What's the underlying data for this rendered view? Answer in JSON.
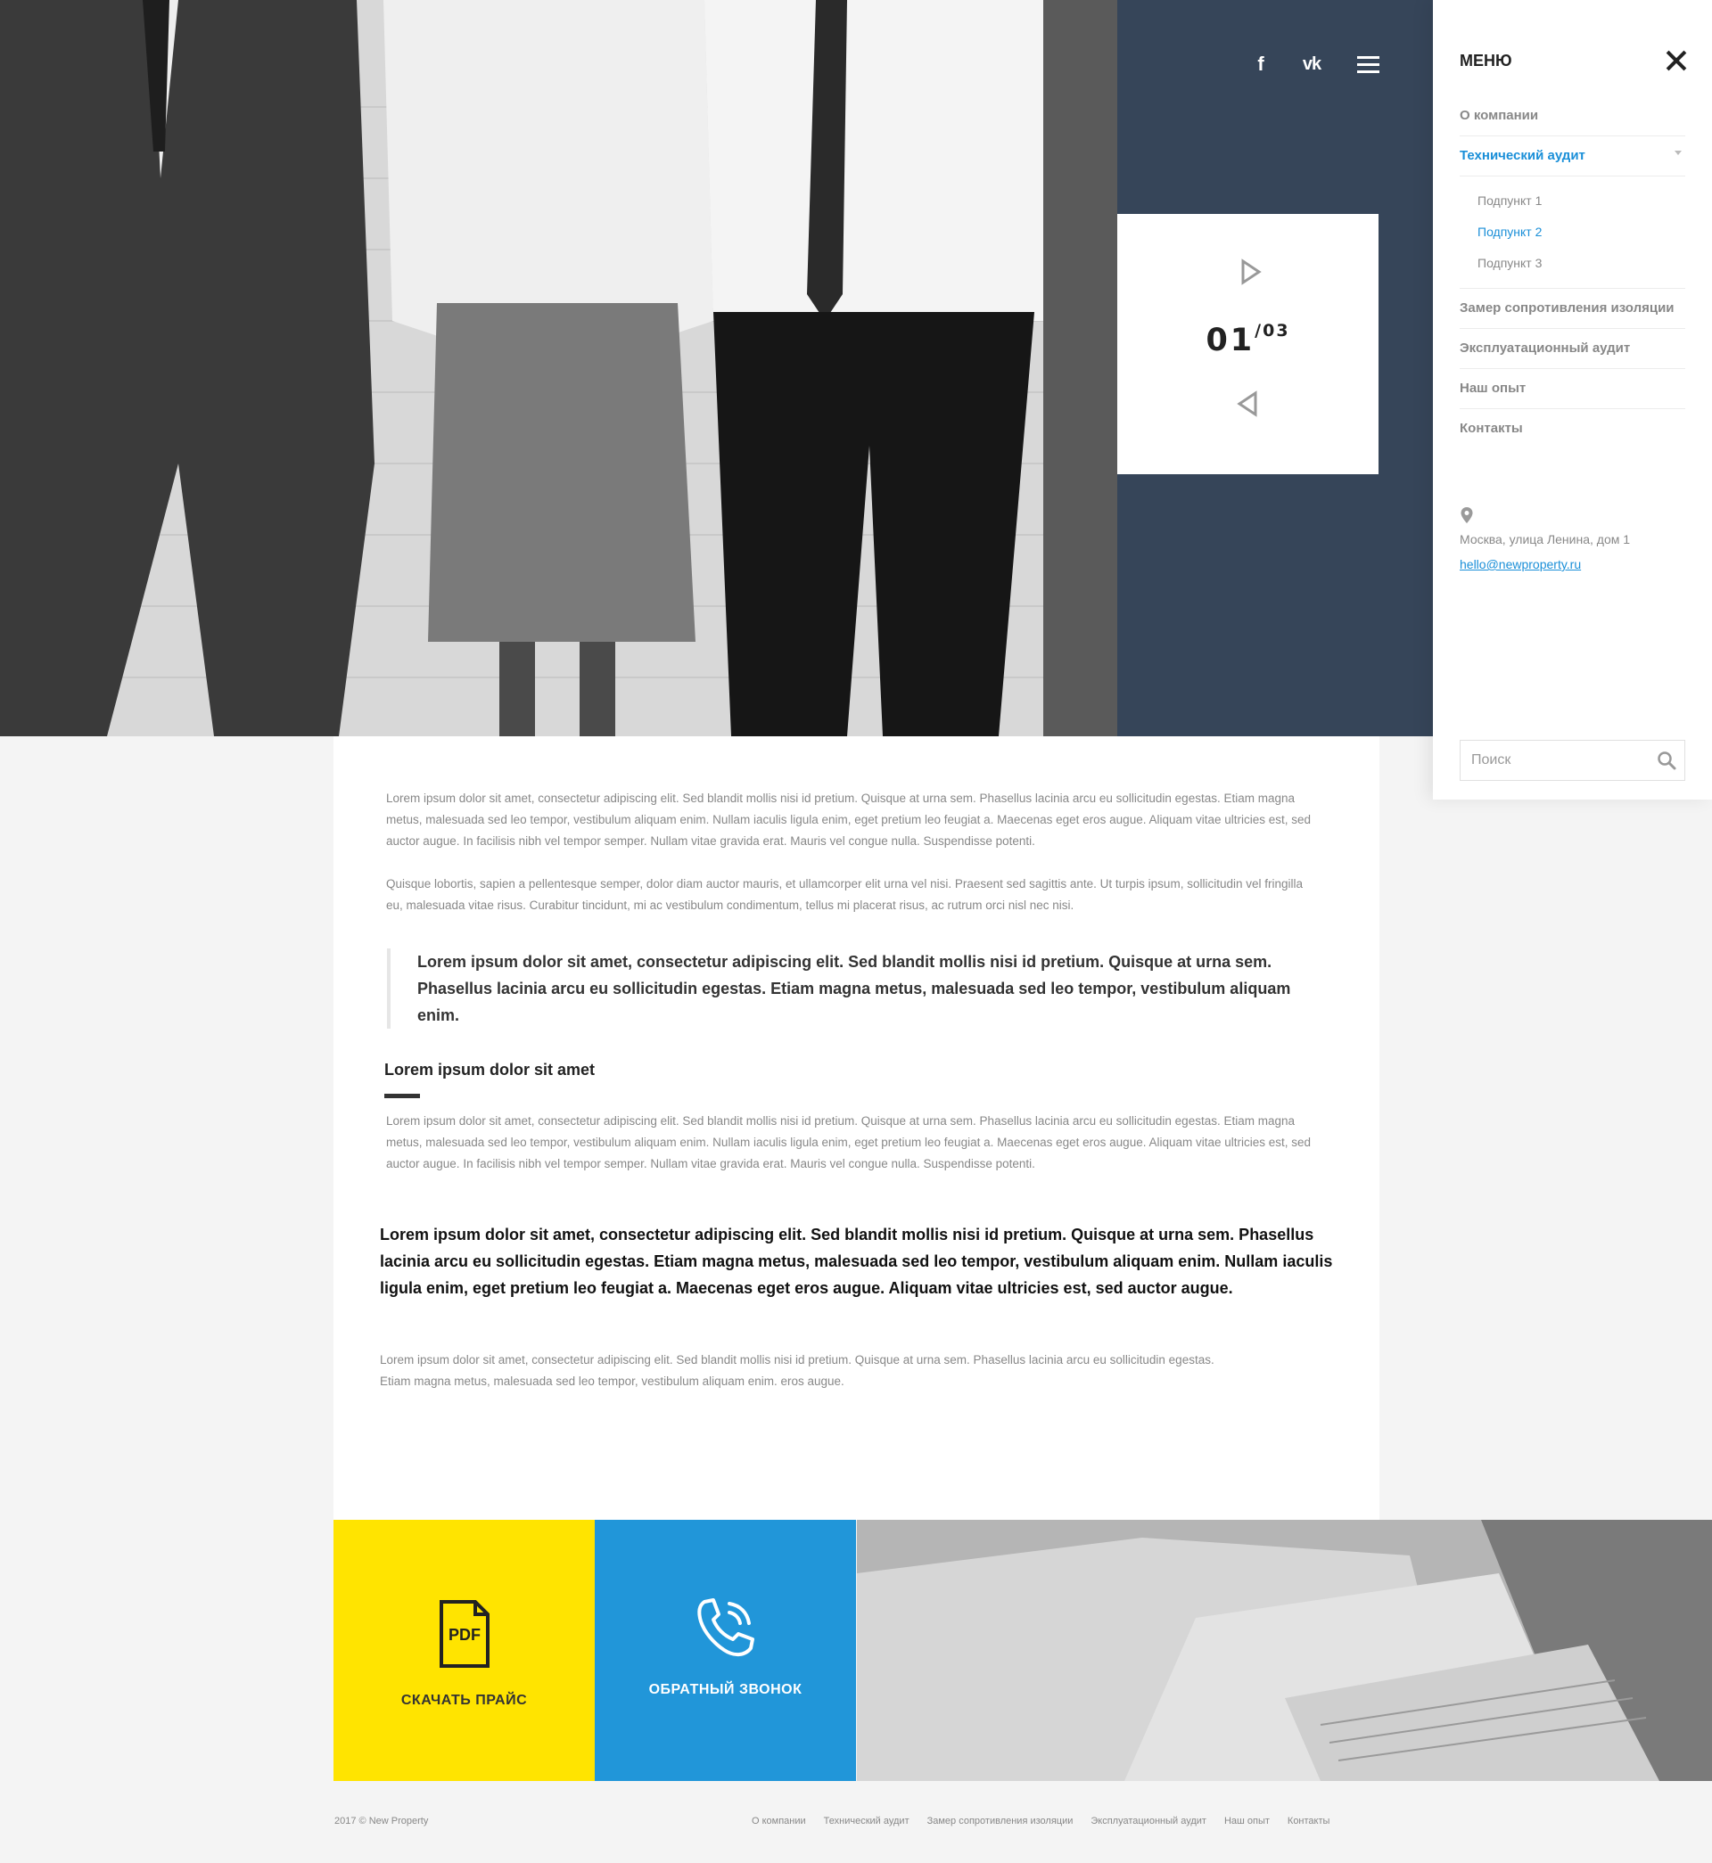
{
  "header": {
    "social": {
      "facebook": "f",
      "vk": "vk"
    }
  },
  "slider": {
    "current": "01",
    "total": "/03"
  },
  "menu": {
    "title": "МЕНЮ",
    "items": [
      {
        "label": "О компании"
      },
      {
        "label": "Технический аудит"
      },
      {
        "label": "Замер сопротивления изоляции"
      },
      {
        "label": "Эксплуатационный аудит"
      },
      {
        "label": "Наш опыт"
      },
      {
        "label": "Контакты"
      }
    ],
    "subitems": [
      {
        "label": "Подпункт 1"
      },
      {
        "label": "Подпункт 2"
      },
      {
        "label": "Подпункт 3"
      }
    ],
    "address": "Москва, улица Ленина, дом 1",
    "email": "hello@newproperty.ru",
    "search_placeholder": "Поиск"
  },
  "article": {
    "p1": "Lorem ipsum dolor sit amet, consectetur adipiscing elit. Sed blandit mollis nisi id pretium. Quisque at urna sem. Phasellus lacinia arcu eu sollicitudin egestas. Etiam magna metus, malesuada sed leo tempor, vestibulum aliquam enim. Nullam iaculis ligula enim, eget pretium leo feugiat a. Maecenas eget eros augue. Aliquam vitae ultricies est, sed auctor augue. In facilisis nibh vel tempor semper. Nullam vitae gravida erat. Mauris vel congue nulla. Suspendisse potenti.",
    "p2": "Quisque lobortis, sapien a pellentesque semper, dolor diam auctor mauris, et ullamcorper elit urna vel nisi. Praesent sed sagittis ante. Ut turpis ipsum, sollicitudin vel fringilla eu, malesuada vitae risus. Curabitur tincidunt, mi ac vestibulum condimentum, tellus mi placerat risus, ac rutrum orci nisl nec nisi.",
    "quote": "Lorem ipsum dolor sit amet, consectetur adipiscing elit. Sed blandit mollis nisi id pretium. Quisque at urna sem. Phasellus lacinia arcu eu sollicitudin egestas. Etiam magna metus, malesuada sed leo tempor, vestibulum aliquam enim.",
    "subheading": "Lorem ipsum dolor sit amet",
    "p3": "Lorem ipsum dolor sit amet, consectetur adipiscing elit. Sed blandit mollis nisi id pretium. Quisque at urna sem. Phasellus lacinia arcu eu sollicitudin egestas. Etiam magna metus, malesuada sed leo tempor, vestibulum aliquam enim. Nullam iaculis ligula enim, eget pretium leo feugiat a. Maecenas eget eros augue. Aliquam vitae ultricies est, sed auctor augue. In facilisis nibh vel tempor semper. Nullam vitae gravida erat. Mauris vel congue nulla. Suspendisse potenti.",
    "lead": "Lorem ipsum dolor sit amet, consectetur adipiscing elit. Sed blandit mollis nisi id pretium. Quisque at urna sem. Phasellus lacinia arcu eu sollicitudin egestas. Etiam magna metus, malesuada sed leo tempor, vestibulum aliquam enim. Nullam iaculis ligula enim, eget pretium leo feugiat a. Maecenas eget eros augue. Aliquam vitae ultricies est, sed auctor augue.",
    "p4": "Lorem ipsum dolor sit amet, consectetur adipiscing elit. Sed blandit mollis nisi id pretium. Quisque at urna sem. Phasellus lacinia arcu eu sollicitudin egestas. Etiam magna metus, malesuada sed leo tempor, vestibulum aliquam enim. eros augue."
  },
  "cta": {
    "pdf_label": "СКАЧАТЬ ПРАЙС",
    "pdf_icon_text": "PDF",
    "call_label": "ОБРАТНЫЙ ЗВОНОК"
  },
  "footer": {
    "copyright": "2017 © New Property",
    "nav": [
      "О компании",
      "Технический аудит",
      "Замер сопротивления изоляции",
      "Эксплуатационный аудит",
      "Наш опыт",
      "Контакты"
    ]
  },
  "colors": {
    "dark_panel": "#364559",
    "accent_blue": "#1a8fd8",
    "cta_yellow": "#ffe400",
    "cta_blue": "#2196d9"
  }
}
